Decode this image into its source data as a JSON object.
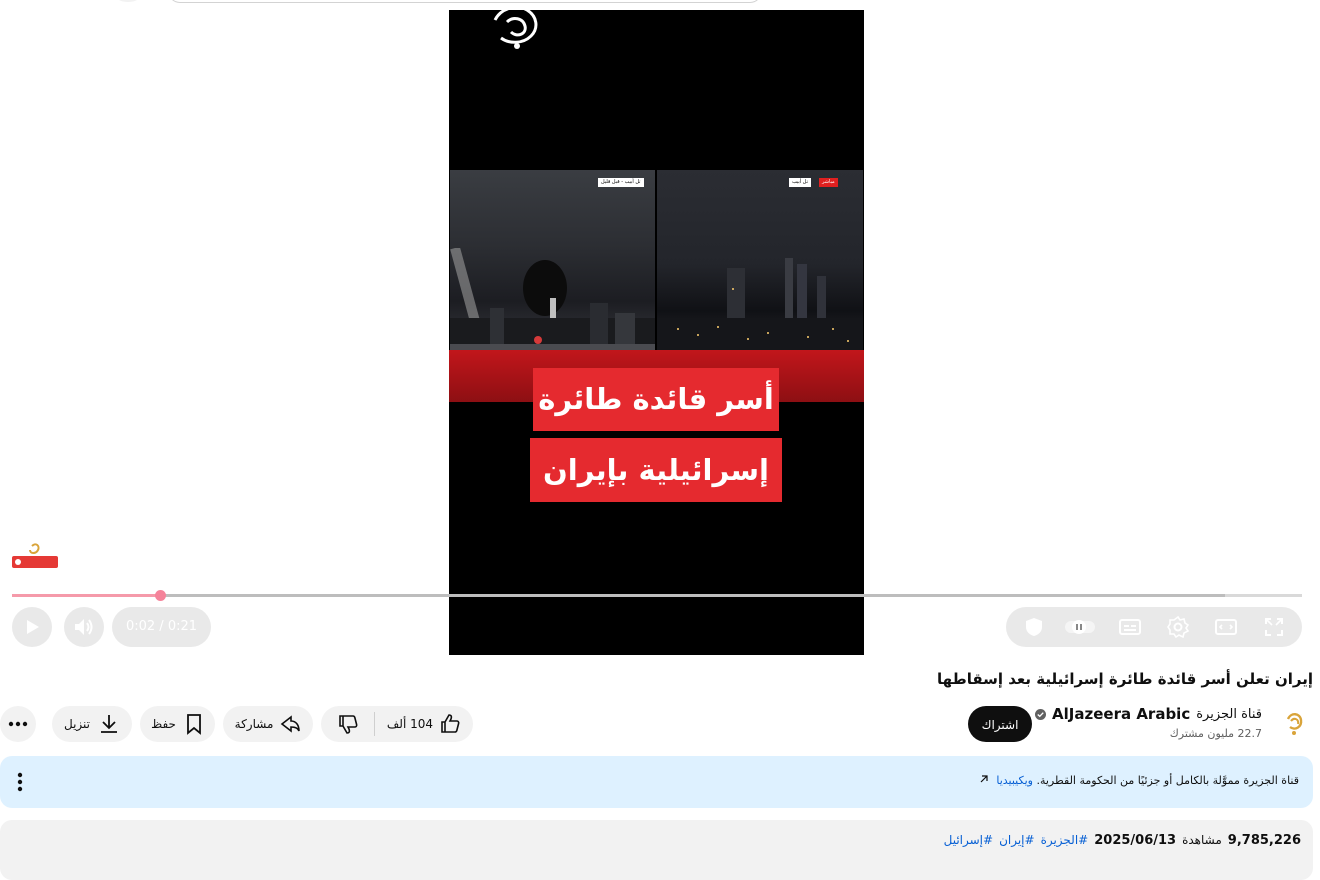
{
  "video": {
    "overlay_line_1": "أسر قائدة طائرة",
    "overlay_line_2": "إسرائيلية بإيران",
    "tag_left": "تل أبيب - قبل قليل",
    "tag_right_place": "تل أبيب",
    "tag_right_live": "مباشر"
  },
  "player": {
    "time": "0:02 / 0:21",
    "progress_fraction": 0.115,
    "buffer_fraction": 0.94,
    "colors": {
      "progress": "#f59aaa",
      "thumb": "#f5839a"
    }
  },
  "title": "إيران تعلن أسر قائدة طائرة إسرائيلية بعد إسقاطها",
  "channel": {
    "name_ar": "قناة الجزيرة",
    "name_en": "AlJazeera Arabic",
    "subscribers": "22.7 مليون مشترك",
    "subscribe_label": "اشتراك"
  },
  "actions": {
    "likes": "104 ألف",
    "share": "مشاركة",
    "save": "حفظ",
    "download": "تنزيل"
  },
  "info_banner": {
    "text": "قناة الجزيرة مموَّلة بالكامل أو جزئيًا من الحكومة القطرية.",
    "link": "ويكيبيديا"
  },
  "description": {
    "views": "9,785,226",
    "views_label": "مشاهدة",
    "date": "2025/06/13",
    "hashtags": [
      "#الجزيرة",
      "#إيران",
      "#إسرائيل"
    ]
  }
}
